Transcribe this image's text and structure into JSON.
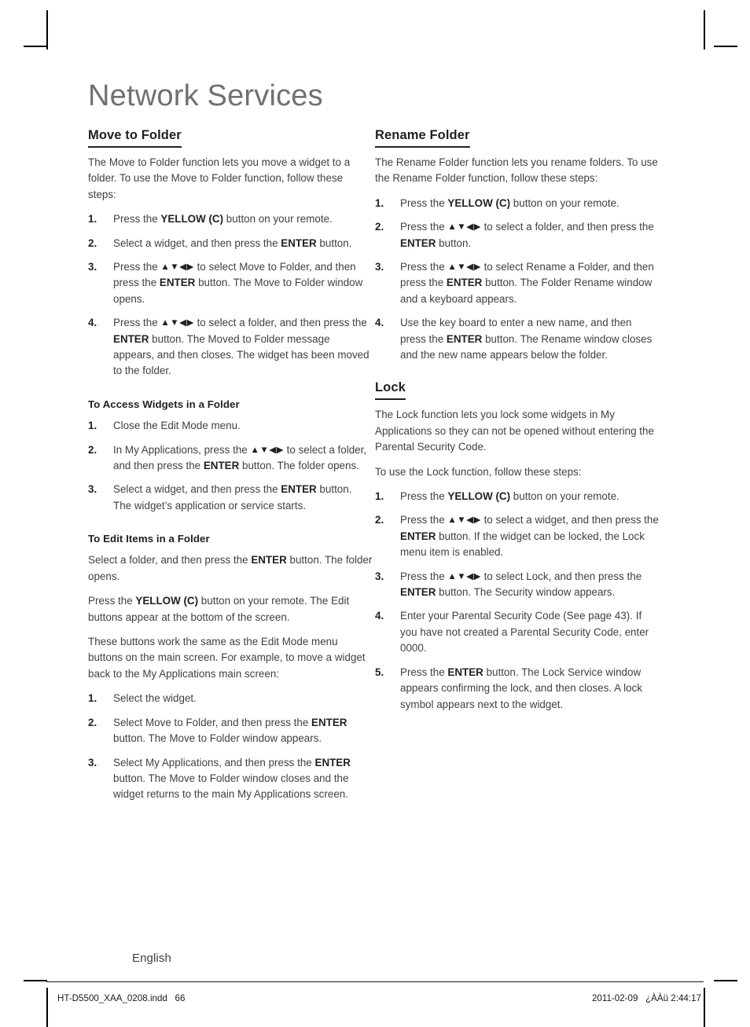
{
  "page": {
    "title": "Network Services",
    "language_label": "English"
  },
  "footer": {
    "file_name": "HT-D5500_XAA_0208.indd",
    "page_number": "66",
    "date": "2011-02-09",
    "time": "¿ÀÀü 2:44:17"
  },
  "arrow_keys": "▲▼◀▶",
  "left_column": {
    "section_heading": "Move to Folder",
    "intro": "The Move to Folder function lets you move a widget to a folder. To use the Move to Folder function, follow these steps:",
    "steps": [
      {
        "num": "1.",
        "parts": [
          {
            "t": "Press the ",
            "b": false
          },
          {
            "t": "YELLOW (C)",
            "b": true
          },
          {
            "t": " button on your remote.",
            "b": false
          }
        ]
      },
      {
        "num": "2.",
        "parts": [
          {
            "t": "Select a widget, and then press the ",
            "b": false
          },
          {
            "t": "ENTER",
            "b": true
          },
          {
            "t": " button.",
            "b": false
          }
        ]
      },
      {
        "num": "3.",
        "parts": [
          {
            "t": "Press the ",
            "b": false
          },
          {
            "t": "▲▼◀▶",
            "b": false,
            "arrows": true
          },
          {
            "t": " to select Move to Folder, and then press the ",
            "b": false
          },
          {
            "t": "ENTER",
            "b": true
          },
          {
            "t": " button. The Move to Folder window opens.",
            "b": false
          }
        ]
      },
      {
        "num": "4.",
        "parts": [
          {
            "t": "Press the ",
            "b": false
          },
          {
            "t": "▲▼◀▶",
            "b": false,
            "arrows": true
          },
          {
            "t": " to select a folder, and then press the ",
            "b": false
          },
          {
            "t": "ENTER",
            "b": true
          },
          {
            "t": " button. The Moved to Folder message appears, and then closes. The widget has been moved to the folder.",
            "b": false
          }
        ]
      }
    ],
    "sub_access": {
      "heading": "To Access Widgets in a Folder",
      "steps": [
        {
          "num": "1.",
          "parts": [
            {
              "t": "Close the Edit Mode menu.",
              "b": false
            }
          ]
        },
        {
          "num": "2.",
          "parts": [
            {
              "t": "In My Applications, press the ",
              "b": false
            },
            {
              "t": "▲▼◀▶",
              "b": false,
              "arrows": true
            },
            {
              "t": " to select a folder, and then press the ",
              "b": false
            },
            {
              "t": "ENTER",
              "b": true
            },
            {
              "t": " button. The folder opens.",
              "b": false
            }
          ]
        },
        {
          "num": "3.",
          "parts": [
            {
              "t": "Select a widget, and then press the ",
              "b": false
            },
            {
              "t": "ENTER",
              "b": true
            },
            {
              "t": " button. The widget’s application or service starts.",
              "b": false
            }
          ]
        }
      ]
    },
    "sub_edit": {
      "heading": "To Edit Items in a Folder",
      "paragraphs": [
        [
          {
            "t": "Select a folder, and then press the ",
            "b": false
          },
          {
            "t": "ENTER",
            "b": true
          },
          {
            "t": " button. The folder opens.",
            "b": false
          }
        ],
        [
          {
            "t": "Press the ",
            "b": false
          },
          {
            "t": "YELLOW (C)",
            "b": true
          },
          {
            "t": " button on your remote. The Edit buttons appear at the bottom of the screen.",
            "b": false
          }
        ],
        [
          {
            "t": "These buttons work the same as the Edit Mode menu buttons on the main screen. For example, to move a widget back to the My Applications main screen:",
            "b": false
          }
        ]
      ],
      "steps": [
        {
          "num": "1.",
          "parts": [
            {
              "t": "Select the widget.",
              "b": false
            }
          ]
        },
        {
          "num": "2.",
          "parts": [
            {
              "t": "Select Move to Folder, and then press the ",
              "b": false
            },
            {
              "t": "ENTER",
              "b": true
            },
            {
              "t": " button. The Move to Folder window appears.",
              "b": false
            }
          ]
        },
        {
          "num": "3.",
          "parts": [
            {
              "t": "Select My Applications, and then press the ",
              "b": false
            },
            {
              "t": "ENTER",
              "b": true
            },
            {
              "t": " button. The Move to Folder window closes and the widget returns to the main My Applications screen.",
              "b": false
            }
          ]
        }
      ]
    }
  },
  "right_column": {
    "rename": {
      "heading": "Rename Folder",
      "intro": "The Rename Folder function lets you rename folders. To use the Rename Folder function, follow these steps:",
      "steps": [
        {
          "num": "1.",
          "parts": [
            {
              "t": "Press the ",
              "b": false
            },
            {
              "t": "YELLOW (C)",
              "b": true
            },
            {
              "t": " button on your remote.",
              "b": false
            }
          ]
        },
        {
          "num": "2.",
          "parts": [
            {
              "t": "Press the ",
              "b": false
            },
            {
              "t": "▲▼◀▶",
              "b": false,
              "arrows": true
            },
            {
              "t": " to select a folder, and then press the ",
              "b": false
            },
            {
              "t": "ENTER",
              "b": true
            },
            {
              "t": " button.",
              "b": false
            }
          ]
        },
        {
          "num": "3.",
          "parts": [
            {
              "t": "Press the ",
              "b": false
            },
            {
              "t": "▲▼◀▶",
              "b": false,
              "arrows": true
            },
            {
              "t": " to select Rename a Folder, and then press the ",
              "b": false
            },
            {
              "t": "ENTER",
              "b": true
            },
            {
              "t": " button. The Folder Rename window and a keyboard appears.",
              "b": false
            }
          ]
        },
        {
          "num": "4.",
          "parts": [
            {
              "t": "Use the key board to enter a new name, and then press the ",
              "b": false
            },
            {
              "t": "ENTER",
              "b": true
            },
            {
              "t": " button. The Rename window closes and the new name appears below the folder.",
              "b": false
            }
          ]
        }
      ]
    },
    "lock": {
      "heading": "Lock",
      "intro": "The Lock function lets you lock some widgets in My Applications so they can not be opened without entering the Parental Security Code.",
      "intro2": "To use the Lock function, follow these steps:",
      "steps": [
        {
          "num": "1.",
          "parts": [
            {
              "t": "Press the ",
              "b": false
            },
            {
              "t": "YELLOW (C)",
              "b": true
            },
            {
              "t": " button on your remote.",
              "b": false
            }
          ]
        },
        {
          "num": "2.",
          "parts": [
            {
              "t": "Press the ",
              "b": false
            },
            {
              "t": "▲▼◀▶",
              "b": false,
              "arrows": true
            },
            {
              "t": " to select a widget, and then press the ",
              "b": false
            },
            {
              "t": "ENTER",
              "b": true
            },
            {
              "t": " button. If the widget can be locked, the Lock menu item is enabled.",
              "b": false
            }
          ]
        },
        {
          "num": "3.",
          "parts": [
            {
              "t": "Press the ",
              "b": false
            },
            {
              "t": "▲▼◀▶",
              "b": false,
              "arrows": true
            },
            {
              "t": " to select Lock, and then press the ",
              "b": false
            },
            {
              "t": "ENTER",
              "b": true
            },
            {
              "t": " button. The Security window appears.",
              "b": false
            }
          ]
        },
        {
          "num": "4.",
          "parts": [
            {
              "t": "Enter your Parental Security Code (See page 43). If you have not created a Parental Security Code, enter 0000.",
              "b": false
            }
          ]
        },
        {
          "num": "5.",
          "parts": [
            {
              "t": "Press the ",
              "b": false
            },
            {
              "t": "ENTER",
              "b": true
            },
            {
              "t": " button. The Lock Service window appears confirming the lock, and then closes. A lock symbol appears next to the widget.",
              "b": false
            }
          ]
        }
      ]
    }
  }
}
